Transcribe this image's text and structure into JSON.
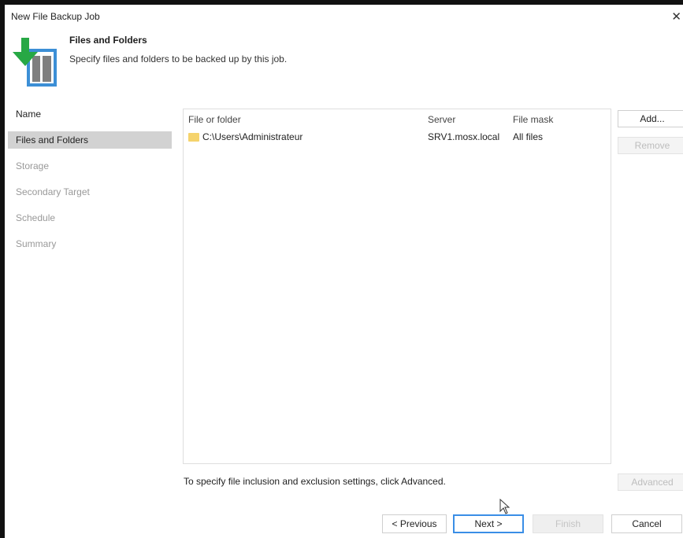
{
  "window": {
    "title": "New File Backup Job",
    "close_glyph": "✕"
  },
  "header": {
    "title": "Files and Folders",
    "subtitle": "Specify files and folders to be backed up by this job.",
    "icon": "file-backup-icon"
  },
  "nav": {
    "items": [
      {
        "label": "Name",
        "state": "done"
      },
      {
        "label": "Files and Folders",
        "state": "active"
      },
      {
        "label": "Storage",
        "state": "pending"
      },
      {
        "label": "Secondary Target",
        "state": "pending"
      },
      {
        "label": "Schedule",
        "state": "pending"
      },
      {
        "label": "Summary",
        "state": "pending"
      }
    ]
  },
  "list": {
    "columns": [
      "File or folder",
      "Server",
      "File mask"
    ],
    "rows": [
      {
        "path": "C:\\Users\\Administrateur",
        "server": "SRV1.mosx.local",
        "mask": "All files",
        "icon": "folder-icon"
      }
    ]
  },
  "side_buttons": {
    "add": "Add...",
    "remove": "Remove",
    "advanced": "Advanced"
  },
  "hint": "To specify file inclusion and exclusion settings, click Advanced.",
  "footer": {
    "previous": "< Previous",
    "next": "Next >",
    "finish": "Finish",
    "cancel": "Cancel"
  },
  "colors": {
    "accent": "#3a8ee6",
    "active_nav": "#d2d2d2",
    "folder": "#f5d36c",
    "icon_green": "#27a845",
    "icon_blue": "#3c8fd6"
  }
}
